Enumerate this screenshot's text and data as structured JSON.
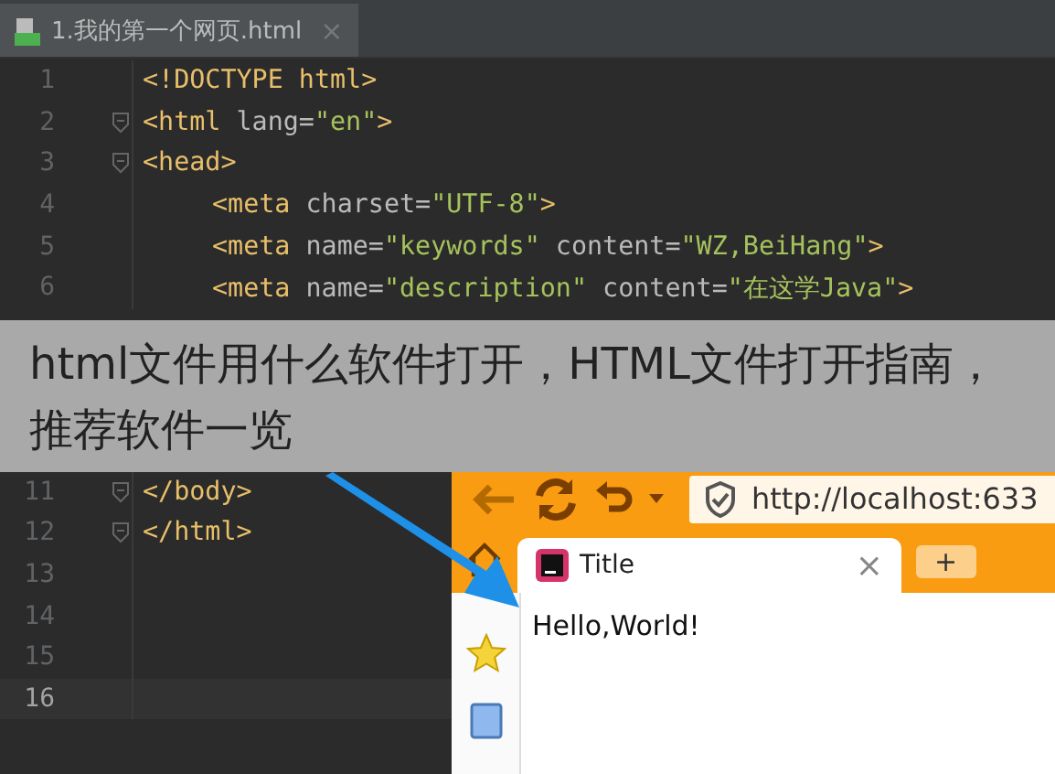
{
  "editor_tab": {
    "label": "1.我的第一个网页.html",
    "close": "×"
  },
  "code_lines": [
    {
      "number": "1",
      "fold": false,
      "current": false,
      "indent": false,
      "segments": [
        {
          "kind": "tag",
          "text": "<!DOCTYPE html>"
        }
      ]
    },
    {
      "number": "2",
      "fold": true,
      "current": false,
      "indent": false,
      "segments": [
        {
          "kind": "tag",
          "text": "<html "
        },
        {
          "kind": "attr",
          "text": "lang="
        },
        {
          "kind": "value",
          "text": "\"en\""
        },
        {
          "kind": "tag",
          "text": ">"
        }
      ]
    },
    {
      "number": "3",
      "fold": true,
      "current": false,
      "indent": false,
      "segments": [
        {
          "kind": "tag",
          "text": "<head>"
        }
      ]
    },
    {
      "number": "4",
      "fold": false,
      "current": false,
      "indent": true,
      "segments": [
        {
          "kind": "tag",
          "text": "<meta "
        },
        {
          "kind": "attr",
          "text": "charset="
        },
        {
          "kind": "value",
          "text": "\"UTF-8\""
        },
        {
          "kind": "tag",
          "text": ">"
        }
      ]
    },
    {
      "number": "5",
      "fold": false,
      "current": false,
      "indent": true,
      "segments": [
        {
          "kind": "tag",
          "text": "<meta "
        },
        {
          "kind": "attr",
          "text": "name="
        },
        {
          "kind": "value",
          "text": "\"keywords\""
        },
        {
          "kind": "attr",
          "text": " content="
        },
        {
          "kind": "value",
          "text": "\"WZ,BeiHang\""
        },
        {
          "kind": "tag",
          "text": ">"
        }
      ]
    },
    {
      "number": "6",
      "fold": false,
      "current": false,
      "indent": true,
      "segments": [
        {
          "kind": "tag",
          "text": "<meta "
        },
        {
          "kind": "attr",
          "text": "name="
        },
        {
          "kind": "value",
          "text": "\"description\""
        },
        {
          "kind": "attr",
          "text": " content="
        },
        {
          "kind": "value",
          "text": "\"在这学Java\""
        },
        {
          "kind": "tag",
          "text": ">"
        }
      ]
    },
    {
      "number": "11",
      "fold": true,
      "current": false,
      "indent": false,
      "segments": [
        {
          "kind": "tag",
          "text": "</body>"
        }
      ]
    },
    {
      "number": "12",
      "fold": true,
      "current": false,
      "indent": false,
      "segments": [
        {
          "kind": "tag",
          "text": "</html>"
        }
      ]
    },
    {
      "number": "13",
      "fold": false,
      "current": false
    },
    {
      "number": "14",
      "fold": false,
      "current": false
    },
    {
      "number": "15",
      "fold": false,
      "current": false
    },
    {
      "number": "16",
      "fold": false,
      "current": true
    }
  ],
  "browser": {
    "address": "http://localhost:633",
    "tab": {
      "title": "Title",
      "close": "×"
    },
    "new_tab": "+",
    "content": "Hello,World!"
  },
  "caption": "html文件用什么软件打开，HTML文件打开指南，推荐软件一览"
}
